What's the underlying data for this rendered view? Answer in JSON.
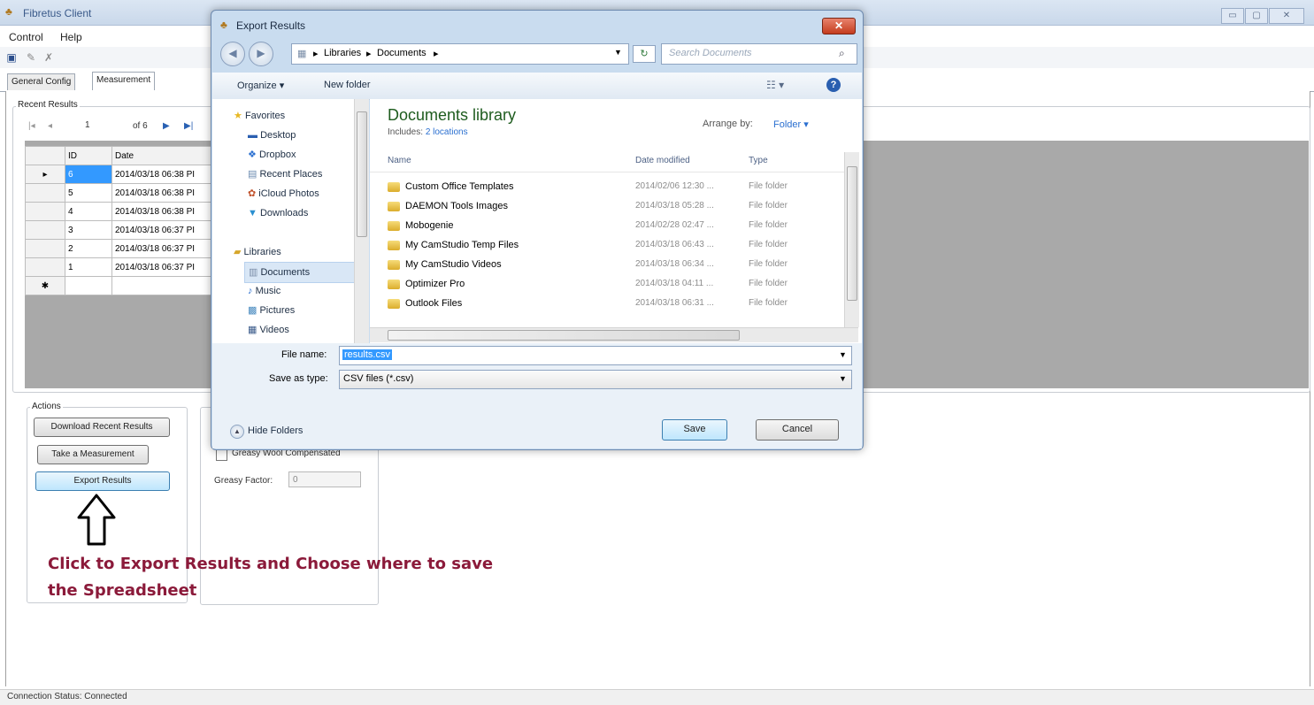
{
  "app": {
    "title": "Fibretus Client",
    "menus": [
      "Control",
      "Help"
    ],
    "tabs": [
      "General Config",
      "Measurement"
    ]
  },
  "recent_results": {
    "group_title": "Recent Results",
    "navigator": {
      "position": "1",
      "of_text": "of 6"
    },
    "columns": [
      "ID",
      "Date"
    ],
    "rows": [
      {
        "id": "6",
        "date": "2014/03/18 06:38 PI"
      },
      {
        "id": "5",
        "date": "2014/03/18 06:38 PI"
      },
      {
        "id": "4",
        "date": "2014/03/18 06:38 PI"
      },
      {
        "id": "3",
        "date": "2014/03/18 06:37 PI"
      },
      {
        "id": "2",
        "date": "2014/03/18 06:37 PI"
      },
      {
        "id": "1",
        "date": "2014/03/18 06:37 PI"
      }
    ]
  },
  "actions": {
    "group_title": "Actions",
    "download_label": "Download Recent Results",
    "measure_label": "Take a Measurement",
    "export_label": "Export Results"
  },
  "options": {
    "greasy_checkbox_label": "Greasy Wool Compensated",
    "greasy_factor_label": "Greasy Factor:",
    "greasy_factor_value": "0"
  },
  "annotation": {
    "line1": "Click to Export Results and Choose where to save",
    "line2": "the Spreadsheet"
  },
  "status": {
    "text": "Connection Status:  Connected"
  },
  "dialog": {
    "title": "Export Results",
    "breadcrumb": [
      "Libraries",
      "Documents"
    ],
    "search_placeholder": "Search Documents",
    "organize_label": "Organize ▾",
    "new_folder_label": "New folder",
    "library_title": "Documents library",
    "includes_label": "Includes:",
    "includes_link": "2 locations",
    "arrange_label": "Arrange by:",
    "arrange_value": "Folder ▾",
    "col_name": "Name",
    "col_date": "Date modified",
    "col_type": "Type",
    "nav_favorites": "Favorites",
    "nav_items": [
      "Desktop",
      "Dropbox",
      "Recent Places",
      "iCloud Photos",
      "Downloads"
    ],
    "nav_libraries": "Libraries",
    "lib_items": [
      "Documents",
      "Music",
      "Pictures",
      "Videos"
    ],
    "files": [
      {
        "name": "Custom Office Templates",
        "date": "2014/02/06 12:30 ...",
        "type": "File folder"
      },
      {
        "name": "DAEMON Tools Images",
        "date": "2014/03/18 05:28 ...",
        "type": "File folder"
      },
      {
        "name": "Mobogenie",
        "date": "2014/02/28 02:47 ...",
        "type": "File folder"
      },
      {
        "name": "My CamStudio Temp Files",
        "date": "2014/03/18 06:43 ...",
        "type": "File folder"
      },
      {
        "name": "My CamStudio Videos",
        "date": "2014/03/18 06:34 ...",
        "type": "File folder"
      },
      {
        "name": "Optimizer Pro",
        "date": "2014/03/18 04:11 ...",
        "type": "File folder"
      },
      {
        "name": "Outlook Files",
        "date": "2014/03/18 06:31 ...",
        "type": "File folder"
      }
    ],
    "file_name_label": "File name:",
    "file_name_value": "results.csv",
    "save_type_label": "Save as type:",
    "save_type_value": "CSV files (*.csv)",
    "hide_folders_label": "Hide Folders",
    "save_label": "Save",
    "cancel_label": "Cancel"
  },
  "colors": {
    "accent": "#3399ff",
    "annotation": "#8b1a3a",
    "dialog_frame": "#c9dcef"
  }
}
